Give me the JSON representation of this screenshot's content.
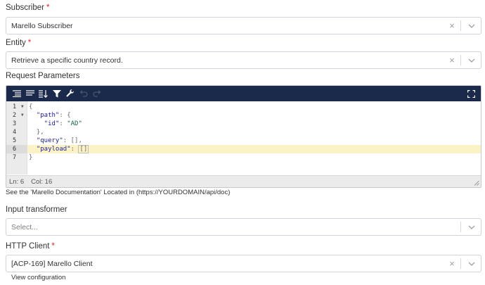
{
  "subscriber": {
    "label": "Subscriber",
    "required_mark": "*",
    "value": "Marello Subscriber",
    "clear": "×"
  },
  "entity": {
    "label": "Entity",
    "required_mark": "*",
    "value": "Retrieve a specific country record.",
    "clear": "×"
  },
  "request_parameters": {
    "label": "Request Parameters",
    "editor": {
      "gutter": [
        "1",
        "2",
        "3",
        "4",
        "5",
        "6",
        "7"
      ],
      "lines": {
        "l1": "{",
        "l2_key": "\"path\"",
        "l2_rest": ": {",
        "l3_key": "\"id\"",
        "l3_sep": ": ",
        "l3_val": "\"AD\"",
        "l4": "},",
        "l5_key": "\"query\"",
        "l5_rest": ": [],",
        "l6_key": "\"payload\"",
        "l6_sep": ": ",
        "l6_val": "[]",
        "l7": "}"
      },
      "status_line": "Ln: 6",
      "status_col": "Col: 16"
    },
    "help_text": "See the 'Marello Documentation' Located in (https://YOURDOMAIN/api/doc)"
  },
  "input_transformer": {
    "label": "Input transformer",
    "placeholder": "Select..."
  },
  "http_client": {
    "label": "HTTP Client",
    "required_mark": "*",
    "value": "[ACP-169] Marello Client",
    "clear": "×",
    "link": "View configuration"
  },
  "colors": {
    "toolbar": "#1b2a4a",
    "required": "#e02424",
    "active_line": "#fbf3c6"
  },
  "icons": [
    "format-icon",
    "compact-icon",
    "sort-icon",
    "filter-icon",
    "wrench-icon",
    "undo-icon",
    "redo-icon",
    "fullscreen-icon",
    "chevron-down-icon",
    "close-icon"
  ]
}
